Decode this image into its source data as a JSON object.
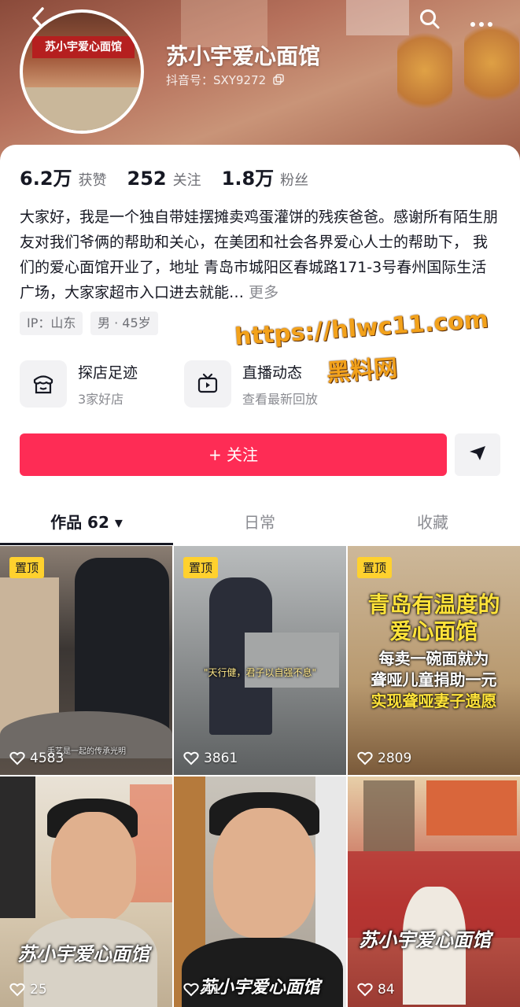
{
  "profile": {
    "name": "苏小宇爱心面馆",
    "douyin_id": "抖音号：SXY9272",
    "avatar_sign": "苏小宇爱心面馆"
  },
  "stats": [
    {
      "value": "6.2万",
      "label": "获赞"
    },
    {
      "value": "252",
      "label": "关注"
    },
    {
      "value": "1.8万",
      "label": "粉丝"
    }
  ],
  "bio": {
    "text": "大家好，我是一个独自带娃摆摊卖鸡蛋灌饼的残疾爸爸。感谢所有陌生朋友对我们爷俩的帮助和关心，在美团和社会各界爱心人士的帮助下， 我们的爱心面馆开业了，地址 青岛市城阳区春城路171-3号春州国际生活广场，大家家超市入口进去就能…",
    "more": "更多"
  },
  "tags": [
    "IP：山东",
    "男 · 45岁"
  ],
  "features": [
    {
      "title": "探店足迹",
      "subtitle": "3家好店",
      "icon": "store-icon"
    },
    {
      "title": "直播动态",
      "subtitle": "查看最新回放",
      "icon": "tv-icon"
    }
  ],
  "actions": {
    "follow": "+ 关注",
    "share_icon": "send-icon"
  },
  "tabs": [
    {
      "label": "作品 62 ▾",
      "active": true
    },
    {
      "label": "日常",
      "active": false
    },
    {
      "label": "收藏",
      "active": false
    }
  ],
  "videos": [
    {
      "pinned": "置顶",
      "likes": "4583",
      "caption": "手艺是一起的传承光明"
    },
    {
      "pinned": "置顶",
      "likes": "3861",
      "caption": "\"天行健，君子以自强不息\""
    },
    {
      "pinned": "置顶",
      "likes": "2809",
      "caption_lines": [
        "青岛有温度的",
        "爱心面馆",
        "每卖一碗面就为",
        "聋哑儿童捐助一元",
        "实现聋哑妻子遗愿"
      ]
    },
    {
      "likes": "25",
      "caption": "苏小宇爱心面馆"
    },
    {
      "likes": "41",
      "caption": "苏小宇爱心面馆"
    },
    {
      "likes": "84",
      "caption": "苏小宇爱心面馆"
    }
  ],
  "watermark": {
    "line1": "https://hlwc11.com",
    "line2": "黑料网"
  },
  "colors": {
    "accent": "#fe2c55",
    "pin": "#ffd12e"
  }
}
